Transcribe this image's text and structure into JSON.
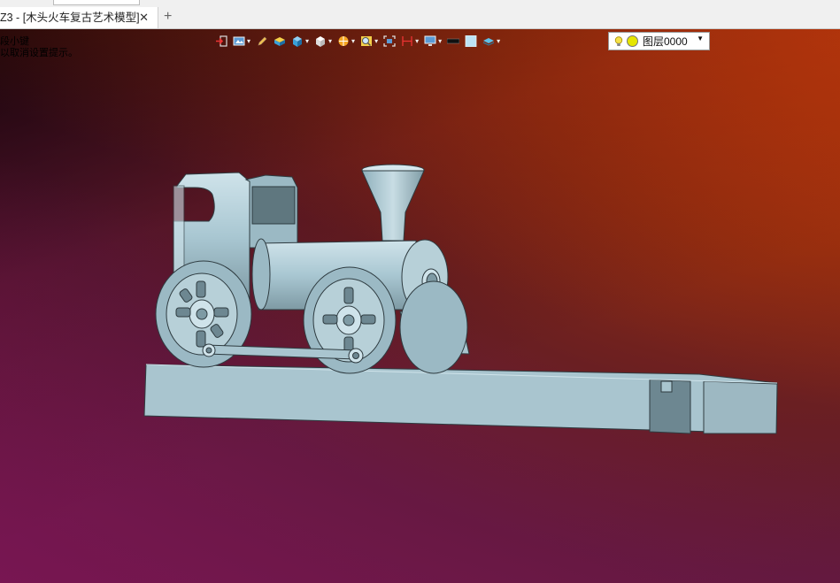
{
  "window": {
    "tab_title": "Z3 - [木头火车复古艺术模型]",
    "tab_close": "✕",
    "new_tab": "+"
  },
  "viewport": {
    "hint_line1": "段小键",
    "hint_line2": "以取消设置提示。"
  },
  "toolbar": {
    "items": [
      "exit-icon",
      "view-style-icon",
      "pen-icon",
      "shade-icon",
      "cube-blue-icon",
      "cube-white-icon",
      "orbit-icon",
      "zoom-icon",
      "fit-icon",
      "dimension-icon",
      "display-icon",
      "color-black-icon",
      "color-lightblue-icon",
      "layer-visual-icon"
    ]
  },
  "layer": {
    "label": "图层0000"
  },
  "colors": {
    "model": "#a9c7d2",
    "model_shadow": "#6f8a94",
    "accent_toolbar": "#e6e600"
  }
}
